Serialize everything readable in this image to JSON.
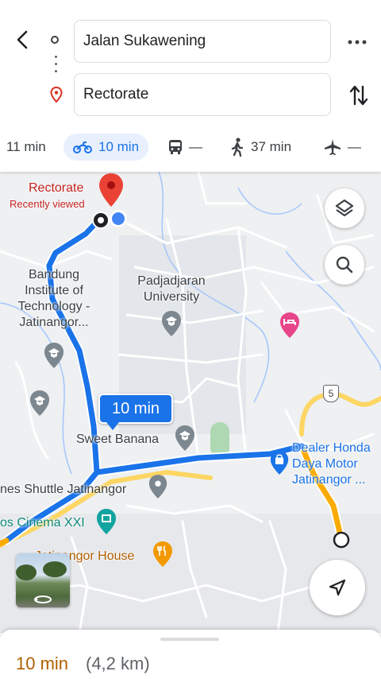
{
  "directions": {
    "from_value": "Jalan Sukawening",
    "to_value": "Rectorate"
  },
  "modes": [
    {
      "name": "driving",
      "icon": "",
      "label": "11 min"
    },
    {
      "name": "motorcycle",
      "icon": "motorcycle-icon",
      "label": "10 min",
      "selected": true
    },
    {
      "name": "transit",
      "icon": "bus-icon",
      "label": "—"
    },
    {
      "name": "walking",
      "icon": "walk-icon",
      "label": "37 min"
    },
    {
      "name": "flights",
      "icon": "plane-icon",
      "label": "—"
    }
  ],
  "map": {
    "destination": {
      "name": "Rectorate",
      "sub": "Recently viewed"
    },
    "places": {
      "itb": "Bandung Institute of Technology - Jatinangor...",
      "unpad": "Padjadjaran University",
      "sweet_banana": "Sweet Banana",
      "dealer": "Dealer Honda Daya Motor Jatinangor ...",
      "shuttle": "nes Shuttle Jatinangor",
      "cinema": "os Cinema XXI",
      "house": "Jatinangor House"
    },
    "road_shield": "5",
    "route_eta": "10 min"
  },
  "summary": {
    "time": "10 min",
    "distance": "(4,2 km)"
  },
  "colors": {
    "route_blue": "#1a73e8",
    "route_orange": "#f9ab00",
    "pin_red": "#ea4335",
    "eta_orange": "#b06000"
  }
}
